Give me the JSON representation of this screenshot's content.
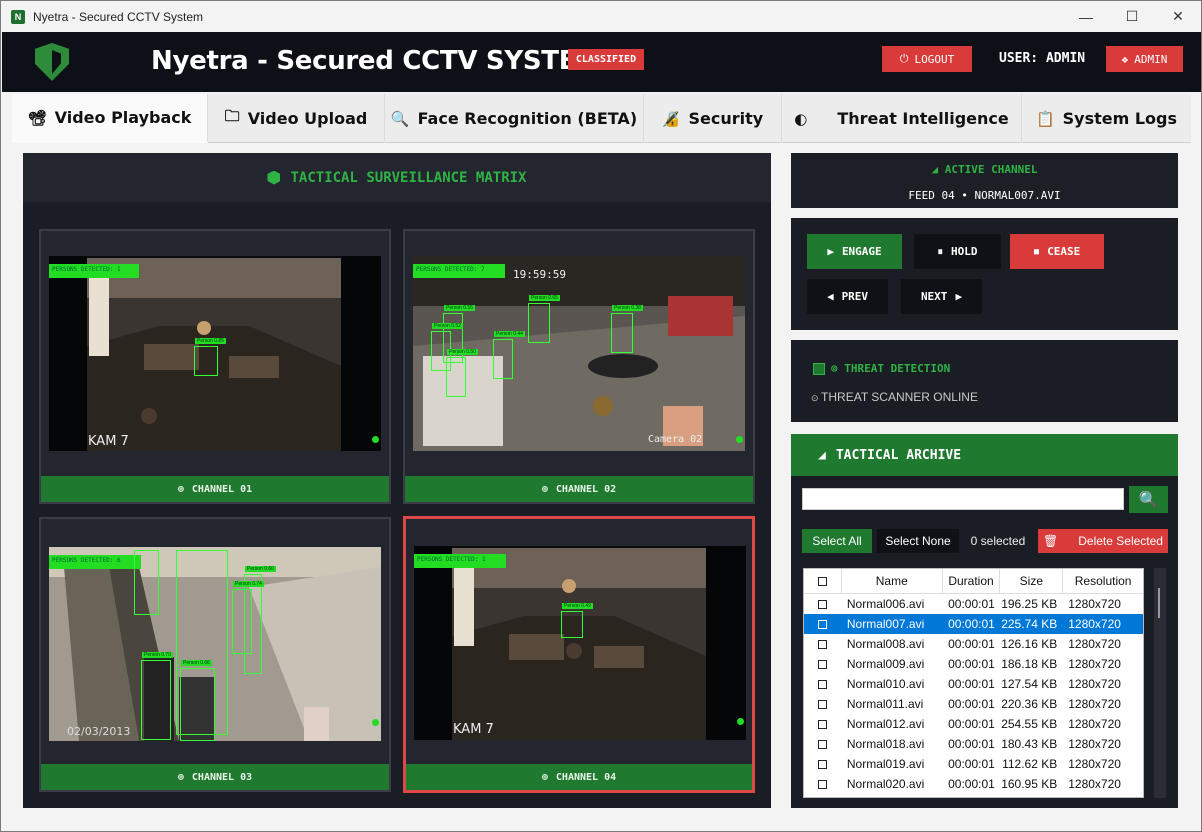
{
  "window": {
    "title": "Nyetra - Secured CCTV System",
    "minimize": "—",
    "maximize": "☐",
    "close": "✕"
  },
  "header": {
    "title": "Nyetra - Secured CCTV SYSTEM",
    "badge": "CLASSIFIED",
    "logout": "LOGOUT",
    "user": "USER: ADMIN",
    "admin": "ADMIN"
  },
  "tabs": [
    {
      "label": "Video Playback",
      "icon": "video-icon"
    },
    {
      "label": "Video Upload",
      "icon": "folder-icon"
    },
    {
      "label": "Face Recognition (BETA)",
      "icon": "magnifier-icon"
    },
    {
      "label": "Security",
      "icon": "lock-icon"
    },
    {
      "label": "Threat Intelligence",
      "icon": "shield-icon"
    },
    {
      "label": "System Logs",
      "icon": "clipboard-icon"
    }
  ],
  "matrix": {
    "title": "TACTICAL SURVEILLANCE MATRIX",
    "channels": [
      {
        "label": "CHANNEL 01",
        "persons": "PERSONS DETECTED: 1",
        "cam": "KAM 7",
        "boxes": [
          "Person 0.85"
        ]
      },
      {
        "label": "CHANNEL 02",
        "persons": "PERSONS DETECTED: 7",
        "cam": "Camera 02",
        "time": "19:59:59",
        "boxes": [
          "Person 0.55",
          "Person 0.52",
          "Person 0.50",
          "Person 0.65",
          "Person 0.44",
          "Person 0.38"
        ]
      },
      {
        "label": "CHANNEL 03",
        "persons": "PERSONS DETECTED: 6",
        "cam": "02/03/2013",
        "boxes": [
          "Person 0.60",
          "Person 0.74",
          "Person 0.70",
          "Person 0.66"
        ]
      },
      {
        "label": "CHANNEL 04",
        "persons": "PERSONS DETECTED: 1",
        "cam": "KAM 7",
        "boxes": [
          "Person 0.49"
        ]
      }
    ]
  },
  "active_channel": {
    "title": "ACTIVE CHANNEL",
    "feed": "FEED 04 • NORMAL007.AVI"
  },
  "controls": {
    "engage": "ENGAGE",
    "hold": "HOLD",
    "cease": "CEASE",
    "prev": "PREV",
    "next": "NEXT"
  },
  "threat": {
    "title": "THREAT DETECTION",
    "status": "THREAT SCANNER ONLINE"
  },
  "archive": {
    "title": "TACTICAL ARCHIVE",
    "search_value": "",
    "select_all": "Select All",
    "select_none": "Select None",
    "selected_count": "0 selected",
    "delete": "Delete Selected",
    "columns": [
      "Name",
      "Duration",
      "Size",
      "Resolution"
    ],
    "rows": [
      {
        "name": "Normal006.avi",
        "duration": "00:00:01",
        "size": "196.25 KB",
        "res": "1280x720"
      },
      {
        "name": "Normal007.avi",
        "duration": "00:00:01",
        "size": "225.74 KB",
        "res": "1280x720"
      },
      {
        "name": "Normal008.avi",
        "duration": "00:00:01",
        "size": "126.16 KB",
        "res": "1280x720"
      },
      {
        "name": "Normal009.avi",
        "duration": "00:00:01",
        "size": "186.18 KB",
        "res": "1280x720"
      },
      {
        "name": "Normal010.avi",
        "duration": "00:00:01",
        "size": "127.54 KB",
        "res": "1280x720"
      },
      {
        "name": "Normal011.avi",
        "duration": "00:00:01",
        "size": "220.36 KB",
        "res": "1280x720"
      },
      {
        "name": "Normal012.avi",
        "duration": "00:00:01",
        "size": "254.55 KB",
        "res": "1280x720"
      },
      {
        "name": "Normal018.avi",
        "duration": "00:00:01",
        "size": "180.43 KB",
        "res": "1280x720"
      },
      {
        "name": "Normal019.avi",
        "duration": "00:00:01",
        "size": "112.62 KB",
        "res": "1280x720"
      },
      {
        "name": "Normal020.avi",
        "duration": "00:00:01",
        "size": "160.95 KB",
        "res": "1280x720"
      }
    ]
  },
  "colors": {
    "accent_green": "#1f7a30",
    "danger_red": "#d93a3a",
    "panel_dark": "#1a1d24",
    "selection_blue": "#0078d7"
  }
}
